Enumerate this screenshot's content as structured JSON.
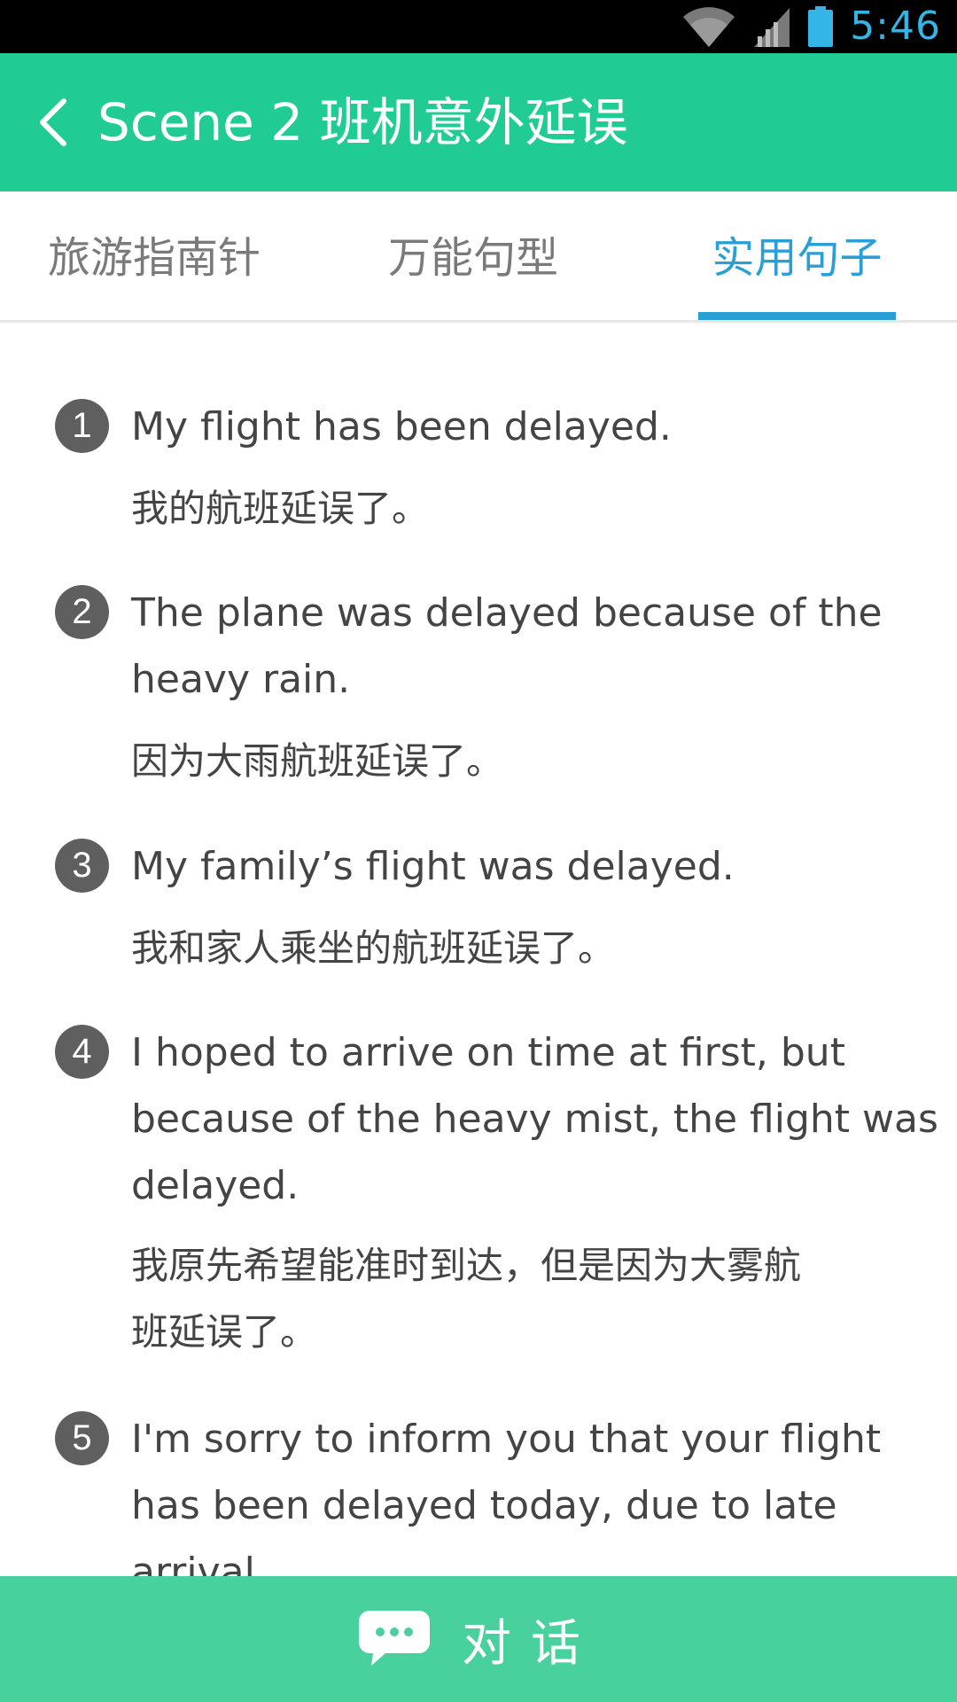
{
  "status_bar": {
    "time": "5:46",
    "icons": [
      "wifi-icon",
      "signal-icon",
      "battery-icon"
    ]
  },
  "header": {
    "back_icon": "chevron-left-icon",
    "title": "Scene 2 班机意外延误"
  },
  "tabs": [
    {
      "label": "旅游指南针",
      "active": false
    },
    {
      "label": "万能句型",
      "active": false
    },
    {
      "label": "实用句子",
      "active": true
    }
  ],
  "sentences": [
    {
      "number": "1",
      "en_lines": [
        "My flight has been delayed."
      ],
      "zh_lines": [
        "我的航班延误了。"
      ]
    },
    {
      "number": "2",
      "en_lines": [
        "The plane was delayed because of the",
        "heavy rain."
      ],
      "zh_lines": [
        "因为大雨航班延误了。"
      ]
    },
    {
      "number": "3",
      "en_lines": [
        "My family’s flight was delayed."
      ],
      "zh_lines": [
        "我和家人乘坐的航班延误了。"
      ]
    },
    {
      "number": "4",
      "en_lines": [
        "I hoped to arrive on time at first, but",
        "because of the heavy mist, the flight was",
        "delayed."
      ],
      "zh_lines": [
        "我原先希望能准时到达，但是因为大雾航",
        "班延误了。"
      ]
    },
    {
      "number": "5",
      "en_lines": [
        "I'm sorry to inform you that your flight",
        "has been delayed today, due to late",
        "arrival."
      ],
      "zh_lines": []
    }
  ],
  "bottom_bar": {
    "icon": "chat-bubble-icon",
    "label": "对话"
  },
  "colors": {
    "app_bar": "#20cc93",
    "bottom_bar": "#48d09d",
    "tab_active": "#2a9fd6",
    "tab_inactive": "#7a7a7a",
    "text": "#444444",
    "badge": "#5f5f5f",
    "status_time": "#33b5e5"
  }
}
